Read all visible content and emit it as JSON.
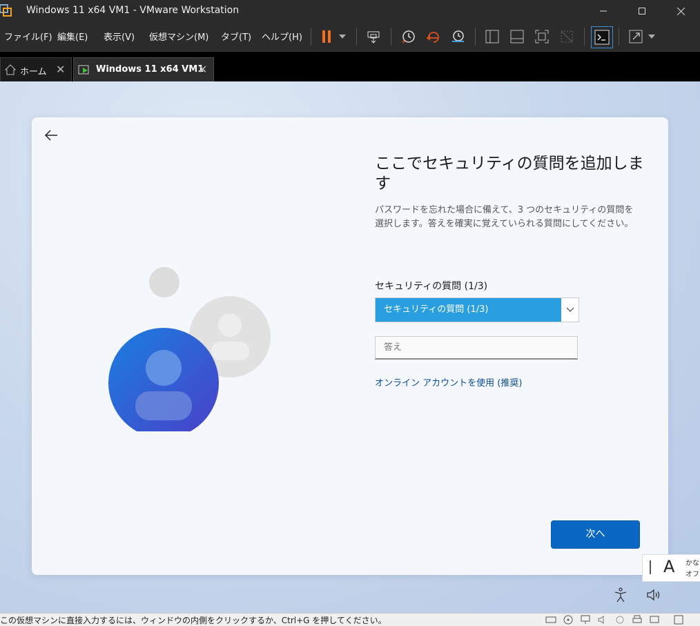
{
  "window": {
    "title": "Windows 11 x64 VM1 - VMware Workstation"
  },
  "menu": {
    "items": [
      "ファイル(F)",
      "編集(E)",
      "表示(V)",
      "仮想マシン(M)",
      "タブ(T)",
      "ヘルプ(H)"
    ]
  },
  "tabs": [
    {
      "label": "ホーム"
    },
    {
      "label": "Windows 11 x64 VM1"
    }
  ],
  "oobe": {
    "heading": "ここでセキュリティの質問を追加します",
    "description": "パスワードを忘れた場合に備えて、3 つのセキュリティの質問を選択します。答えを確実に覚えていられる質問にしてください。",
    "question_label": "セキュリティの質問 (1/3)",
    "question_selected": "セキュリティの質問 (1/3)",
    "answer_placeholder": "答え",
    "online_account_link": "オンライン アカウントを使用 (推奨)",
    "next_button": "次へ"
  },
  "ime": {
    "mode_letter": "A",
    "mode_line1": "かな",
    "mode_line2": "オフ"
  },
  "statusbar": {
    "message": "この仮想マシンに直接入力するには、ウィンドウの内側をクリックするか、Ctrl+G を押してください。"
  },
  "colors": {
    "accent_blue": "#0a67c2",
    "select_highlight": "#2a9fe0",
    "link": "#0a4e92",
    "pause_orange": "#f07020"
  }
}
